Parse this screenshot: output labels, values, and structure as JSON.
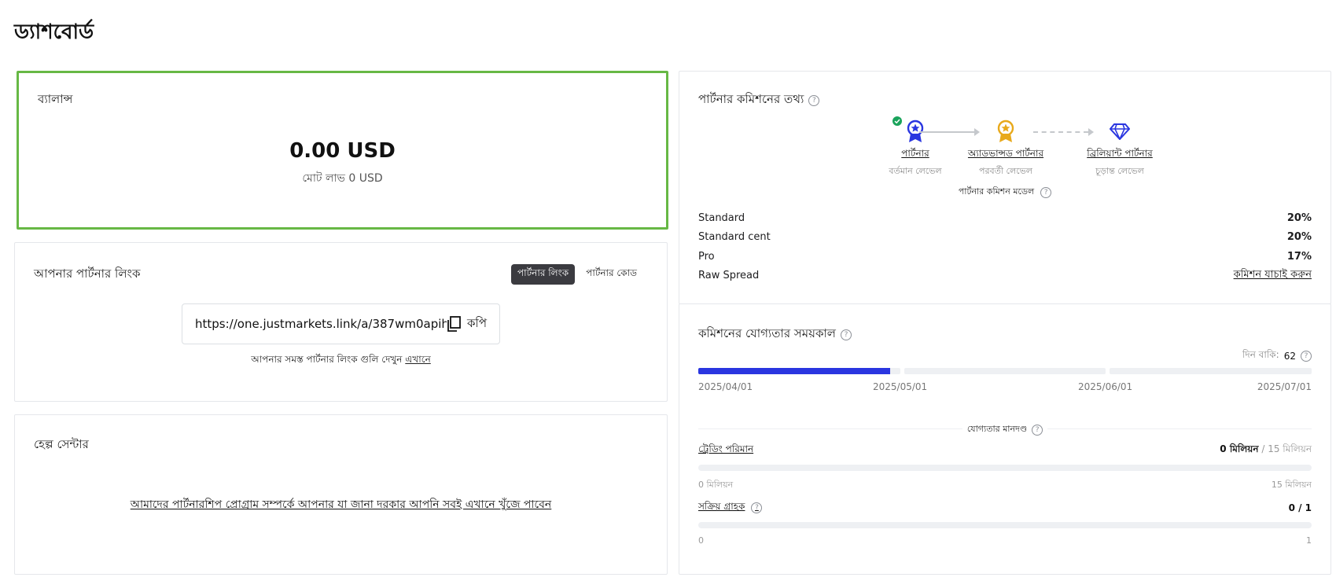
{
  "page": {
    "title": "ড্যাশবোর্ড"
  },
  "balance": {
    "title": "ব্যালান্স",
    "amount": "0.00 USD",
    "total_label": "মোট লাভ 0 USD"
  },
  "partner_link": {
    "title": "আপনার পার্টনার লিংক",
    "tabs": [
      {
        "label": "পার্টনার লিংক",
        "active": true
      },
      {
        "label": "পার্টনার কোড",
        "active": false
      }
    ],
    "url": "https://one.justmarkets.link/a/387wm0apih",
    "copy_label": "কপি",
    "hint_text": "আপনার সমস্ত পার্টনার লিংক গুলি দেখুন ",
    "hint_link": "এখানে"
  },
  "help": {
    "title": "হেল্প সেন্টার",
    "link": "আমাদের পার্টনারশিপ প্রোগ্রাম সম্পর্কে আপনার যা জানা দরকার আপনি সবই এখানে খুঁজে পাবেন"
  },
  "commission": {
    "title": "পার্টনার কমিশনের তথ্য",
    "levels": [
      {
        "name": "পার্টনার",
        "sub": "বর্তমান লেভেল",
        "icon": "medal-star-icon",
        "color": "#2a36e0",
        "current": true
      },
      {
        "name": "অ্যাডভান্সড পার্টনার",
        "sub": "পরবর্তী লেভেল",
        "icon": "medal-star-icon",
        "color": "#e8a91b",
        "current": false
      },
      {
        "name": "ব্রিলিয়ান্ট পার্টনার",
        "sub": "চূড়ান্ত লেভেল",
        "icon": "diamond-icon",
        "color": "#2a36e0",
        "current": false
      }
    ],
    "model_title": "পার্টনার কমিশন মডেল",
    "rates": [
      {
        "name": "Standard",
        "value": "20%"
      },
      {
        "name": "Standard cent",
        "value": "20%"
      },
      {
        "name": "Pro",
        "value": "17%"
      },
      {
        "name": "Raw Spread",
        "link": "কমিশন যাচাই করুন"
      }
    ]
  },
  "period": {
    "title": "কমিশনের যোগ্যতার সময়কাল",
    "days_left_label": "দিন বাকি:",
    "days_left": "62",
    "dates": [
      "2025/04/01",
      "2025/05/01",
      "2025/06/01",
      "2025/07/01"
    ],
    "progress_segments": [
      0.95,
      0,
      0
    ],
    "criteria_title": "যোগ্যতার মানদণ্ড",
    "criteria": [
      {
        "label": "ট্রেডিং পরিমান",
        "value": "0 মিলিয়ন",
        "max": " / 15 মিলিয়ন",
        "fraction": 0,
        "min_label": "0 মিলিয়ন",
        "max_label": "15 মিলিয়ন",
        "help": false
      },
      {
        "label": "সক্রিয় গ্রাহক",
        "value": "0 / 1",
        "max": "",
        "fraction": 0,
        "min_label": "0",
        "max_label": "1",
        "help": true
      }
    ]
  },
  "colors": {
    "accent": "#2a36e0",
    "balance_border": "#67b845",
    "check": "#1aa35b",
    "gold": "#e8a91b"
  }
}
